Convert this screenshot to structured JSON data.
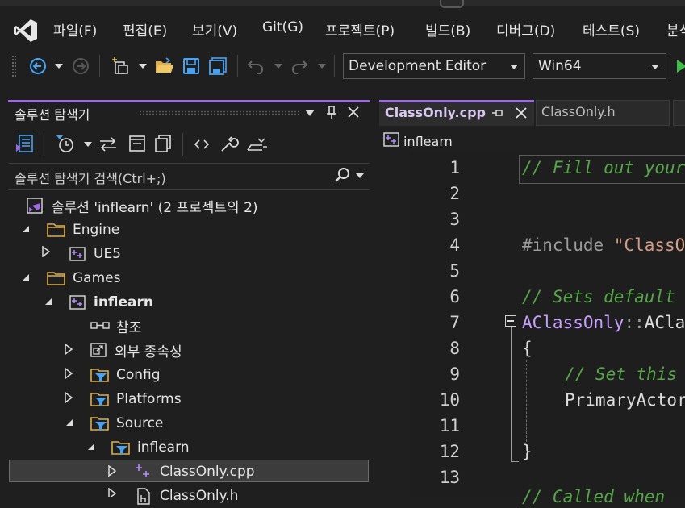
{
  "menu": {
    "items": [
      "파일(F)",
      "편집(E)",
      "보기(V)",
      "Git(G)",
      "프로젝트(P)",
      "빌드(B)",
      "디버그(D)",
      "테스트(S)",
      "분석"
    ]
  },
  "toolbar": {
    "config_combo": "Development Editor",
    "platform_combo": "Win64"
  },
  "solution_explorer": {
    "title": "솔루션 탐색기",
    "search_placeholder": "솔루션 탐색기 검색(Ctrl+;)",
    "tree": {
      "solution": "솔루션 'inflearn'  (2 프로젝트의 2)",
      "engine": "Engine",
      "ue5": "UE5",
      "games": "Games",
      "inflearn_project": "inflearn",
      "references": "참조",
      "external_deps": "외부 종속성",
      "config": "Config",
      "platforms": "Platforms",
      "source": "Source",
      "inflearn_folder": "inflearn",
      "classonly_cpp": "ClassOnly.cpp",
      "classonly_h": "ClassOnly.h"
    }
  },
  "editor": {
    "tabs": [
      {
        "label": "ClassOnly.cpp",
        "active": true
      },
      {
        "label": "ClassOnly.h",
        "active": false
      }
    ],
    "nav_project": "inflearn",
    "line_numbers": [
      "1",
      "2",
      "3",
      "4",
      "5",
      "6",
      "7",
      "8",
      "9",
      "10",
      "11",
      "12",
      "13"
    ],
    "code": {
      "l1": "// Fill out your",
      "l4_pre": "#include ",
      "l4_str": "\"ClassO",
      "l6": "// Sets default",
      "l7_type": "AClassOnly",
      "l7_sep": "::",
      "l7_rest": "AClas",
      "l8": "{",
      "l9": "// Set this",
      "l10": "PrimaryActorT",
      "l12": "}",
      "l14": "// Called when"
    }
  },
  "colors": {
    "accent": "#9b6bdf",
    "comment": "#57a64a",
    "string": "#d69d85",
    "type": "#c8a0ff"
  }
}
